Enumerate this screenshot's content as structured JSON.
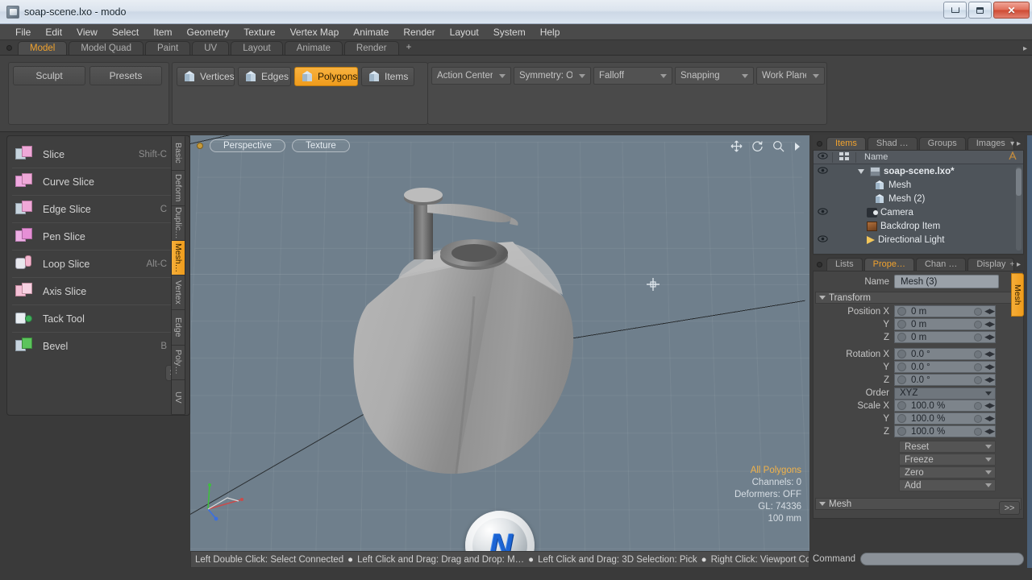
{
  "window": {
    "title": "soap-scene.lxo - modo",
    "icon": "app-icon",
    "controls": {
      "minimize": "–",
      "maximize": "❐",
      "close": "✕"
    }
  },
  "menubar": {
    "items": [
      "File",
      "Edit",
      "View",
      "Select",
      "Item",
      "Geometry",
      "Texture",
      "Vertex Map",
      "Animate",
      "Render",
      "Layout",
      "System",
      "Help"
    ]
  },
  "layout_tabs": {
    "items": [
      "Model",
      "Model Quad",
      "Paint",
      "UV",
      "Layout",
      "Animate",
      "Render"
    ],
    "active": "Model",
    "plus": "+",
    "overflow": "▸"
  },
  "toolbar": {
    "left_buttons": [
      "Sculpt",
      "Presets"
    ],
    "selection_modes": [
      {
        "label": "Vertices",
        "active": false
      },
      {
        "label": "Edges",
        "active": false
      },
      {
        "label": "Polygons",
        "active": true
      },
      {
        "label": "Items",
        "active": false
      }
    ],
    "dropdowns": [
      "Action Center",
      "Symmetry: Off",
      "Falloff",
      "Snapping",
      "Work Plane"
    ]
  },
  "tool_panel": {
    "tools": [
      {
        "label": "Slice",
        "shortcut": "Shift-C",
        "icon": "slice-icon"
      },
      {
        "label": "Curve Slice",
        "shortcut": "",
        "icon": "curve-slice-icon"
      },
      {
        "label": "Edge Slice",
        "shortcut": "C",
        "icon": "edge-slice-icon"
      },
      {
        "label": "Pen Slice",
        "shortcut": "",
        "icon": "pen-slice-icon"
      },
      {
        "label": "Loop Slice",
        "shortcut": "Alt-C",
        "icon": "loop-slice-icon"
      },
      {
        "label": "Axis Slice",
        "shortcut": "",
        "icon": "axis-slice-icon"
      },
      {
        "label": "Tack Tool",
        "shortcut": "",
        "icon": "tack-tool-icon"
      },
      {
        "label": "Bevel",
        "shortcut": "B",
        "icon": "bevel-icon"
      }
    ],
    "expand_label": ">>",
    "vertical_tabs": [
      "Basic",
      "Deform",
      "Duplic…",
      "Mesh…",
      "Vertex",
      "Edge",
      "Poly…",
      "UV"
    ],
    "vertical_tabs_active": "Mesh…"
  },
  "viewport": {
    "tabs": [
      "Perspective",
      "Texture"
    ],
    "nav_icons": [
      "move-icon",
      "rotate-icon",
      "zoom-icon",
      "play-icon"
    ],
    "info": {
      "selection": "All Polygons",
      "channels": "Channels: 0",
      "deformers": "Deformers: OFF",
      "gl": "GL: 74336",
      "scale": "100 mm"
    },
    "gizmo_axes": [
      "X",
      "Y",
      "Z"
    ],
    "watermark": "N"
  },
  "statusbar": {
    "segments": [
      "Left Double Click: Select Connected",
      "Left Click and Drag: Drag and Drop: M…",
      "Left Click and Drag: 3D Selection: Pick",
      "Right Click: Viewport Context …"
    ],
    "separator": "●"
  },
  "item_list": {
    "tabs": [
      "Items",
      "Shad …",
      "Groups",
      "Images"
    ],
    "active_tab": "Items",
    "overflow": "▾ ▸",
    "columns": {
      "eye": "eye-icon",
      "x": "xform-icon",
      "name": "Name",
      "tail": "tail-icon"
    },
    "rows": [
      {
        "name": "soap-scene.lxo*",
        "icon": "scene-icon",
        "indent": 0,
        "eye": true,
        "expanded": true
      },
      {
        "name": "Mesh",
        "icon": "mesh-icon",
        "indent": 1,
        "eye": false
      },
      {
        "name": "Mesh (2)",
        "icon": "mesh-icon",
        "indent": 1,
        "eye": false
      },
      {
        "name": "Camera",
        "icon": "camera-icon",
        "indent": 1,
        "eye": true
      },
      {
        "name": "Backdrop Item",
        "icon": "backdrop-icon",
        "indent": 1,
        "eye": false
      },
      {
        "name": "Directional Light",
        "icon": "light-icon",
        "indent": 1,
        "eye": true
      }
    ]
  },
  "properties": {
    "tabs": [
      "Lists",
      "Prope…",
      "Chan …",
      "Display"
    ],
    "active_tab": "Prope…",
    "plus": "+ ▸",
    "name_label": "Name",
    "name_value": "Mesh (3)",
    "transform_header": "Transform",
    "fields": [
      {
        "label": "Position X",
        "value": "0 m"
      },
      {
        "label": "Y",
        "value": "0 m"
      },
      {
        "label": "Z",
        "value": "0 m"
      },
      {
        "label": "Rotation X",
        "value": "0.0 °"
      },
      {
        "label": "Y",
        "value": "0.0 °"
      },
      {
        "label": "Z",
        "value": "0.0 °"
      }
    ],
    "order_label": "Order",
    "order_value": "XYZ",
    "scale_fields": [
      {
        "label": "Scale X",
        "value": "100.0 %"
      },
      {
        "label": "Y",
        "value": "100.0 %"
      },
      {
        "label": "Z",
        "value": "100.0 %"
      }
    ],
    "actions": [
      "Reset",
      "Freeze",
      "Zero",
      "Add"
    ],
    "mesh_header": "Mesh",
    "side_tab": "Mesh",
    "expand_label": ">>"
  },
  "command_bar": {
    "label": "Command",
    "value": "",
    "placeholder": ""
  }
}
